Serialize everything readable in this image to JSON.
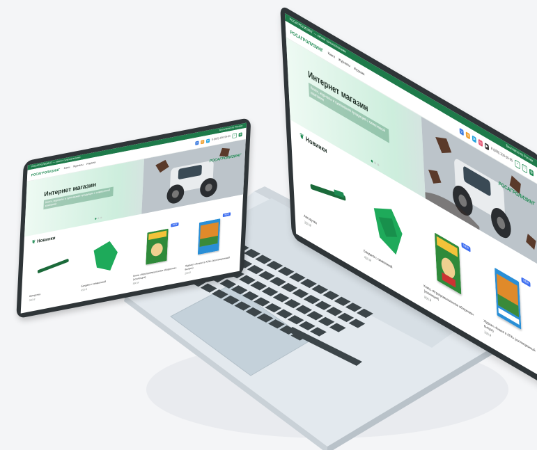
{
  "site": {
    "topbar_left": "РОСАГРОЛИЗИНГ — лизинг сельхозтехники",
    "topbar_right": "Бесплатно по России",
    "logo": "РОСАГРОЛИЗИНГ",
    "nav": [
      "Книги",
      "Журналы",
      "Игрушки"
    ],
    "phone": "8 (800) 200-59-95",
    "hero_title": "Интернет магазин",
    "hero_subtitle": "Книги, журналы и сувенирная продукция с символикой компании",
    "banner_brand": "РОСАГРОЛИЗИНГ",
    "section_title": "Новинки",
    "badge_new": "NEW",
    "products": [
      {
        "name": "Авторучка",
        "price": "350 ₽"
      },
      {
        "name": "Бандана с символикой",
        "price": "450 ₽"
      },
      {
        "name": "Книга «Агропромышленное обозрение» (коллекция)",
        "price": "890 ₽"
      },
      {
        "name": "Журнал «Лизинг в АПК» (коллекционный выпуск)",
        "price": "290 ₽"
      }
    ]
  },
  "colors": {
    "brand_green": "#1e8a52",
    "topbar_green": "#1e7a4a",
    "badge_blue": "#3e6ef0",
    "device_frame": "#2f3538",
    "laptop_body": "#e3e9ee",
    "key": "#3c4549"
  }
}
